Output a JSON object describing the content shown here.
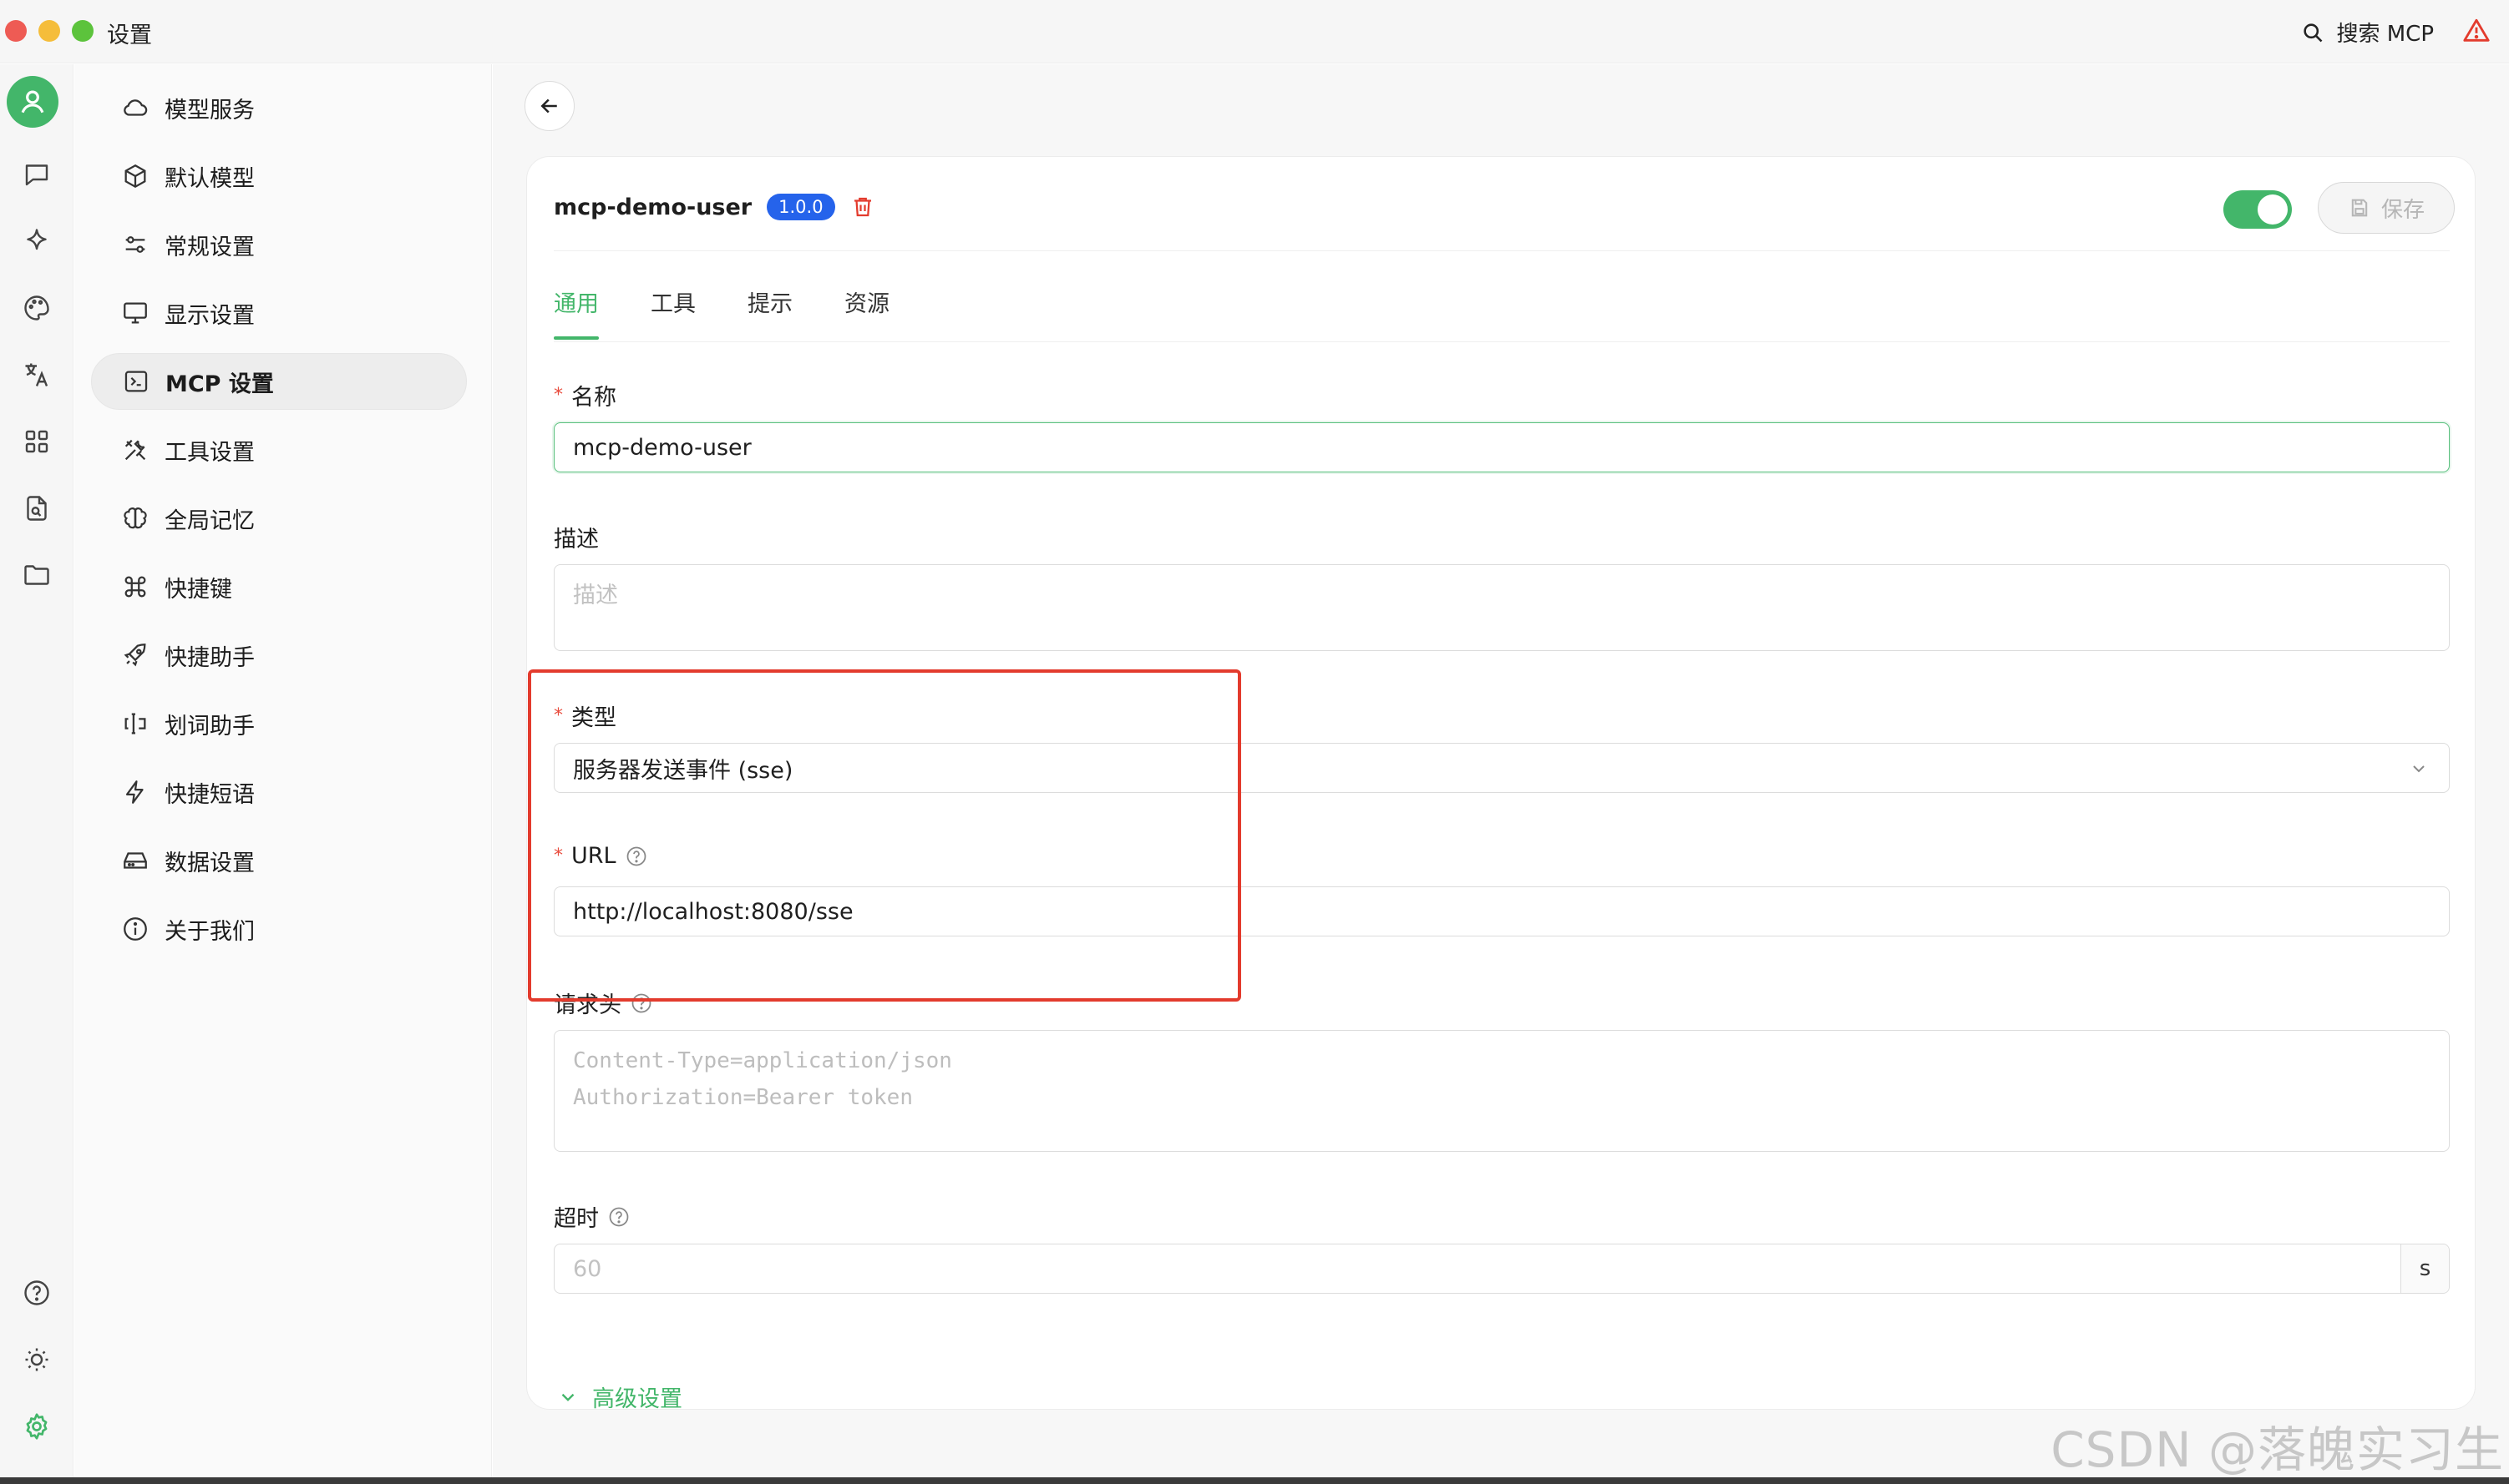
{
  "window": {
    "title": "设置",
    "search_label": "搜索 MCP"
  },
  "nav": {
    "items": [
      {
        "label": "模型服务",
        "icon": "cloud-icon"
      },
      {
        "label": "默认模型",
        "icon": "cube-icon"
      },
      {
        "label": "常规设置",
        "icon": "sliders-icon"
      },
      {
        "label": "显示设置",
        "icon": "monitor-icon"
      },
      {
        "label": "MCP 设置",
        "icon": "terminal-icon",
        "active": true
      },
      {
        "label": "工具设置",
        "icon": "tools-icon"
      },
      {
        "label": "全局记忆",
        "icon": "brain-icon"
      },
      {
        "label": "快捷键",
        "icon": "command-icon"
      },
      {
        "label": "快捷助手",
        "icon": "rocket-icon"
      },
      {
        "label": "划词助手",
        "icon": "text-cursor-icon"
      },
      {
        "label": "快捷短语",
        "icon": "zap-icon"
      },
      {
        "label": "数据设置",
        "icon": "hard-drive-icon"
      },
      {
        "label": "关于我们",
        "icon": "info-icon"
      }
    ]
  },
  "server": {
    "name": "mcp-demo-user",
    "version": "1.0.0",
    "enabled": true,
    "save_label": "保存"
  },
  "tabs": [
    "通用",
    "工具",
    "提示",
    "资源"
  ],
  "form": {
    "name_label": "名称",
    "name_value": "mcp-demo-user",
    "description_label": "描述",
    "description_placeholder": "描述",
    "type_label": "类型",
    "type_value": "服务器发送事件 (sse)",
    "url_label": "URL",
    "url_value": "http://localhost:8080/sse",
    "headers_label": "请求头",
    "headers_placeholder_line1": "Content-Type=application/json",
    "headers_placeholder_line2": "Authorization=Bearer token",
    "timeout_label": "超时",
    "timeout_placeholder": "60",
    "timeout_unit": "s",
    "advanced_label": "高级设置"
  },
  "colors": {
    "accent": "#43b66a",
    "badge": "#2563eb",
    "danger": "#e33b2d",
    "highlight_box": "#e33b2d"
  },
  "watermark": "CSDN @落魄实习生"
}
